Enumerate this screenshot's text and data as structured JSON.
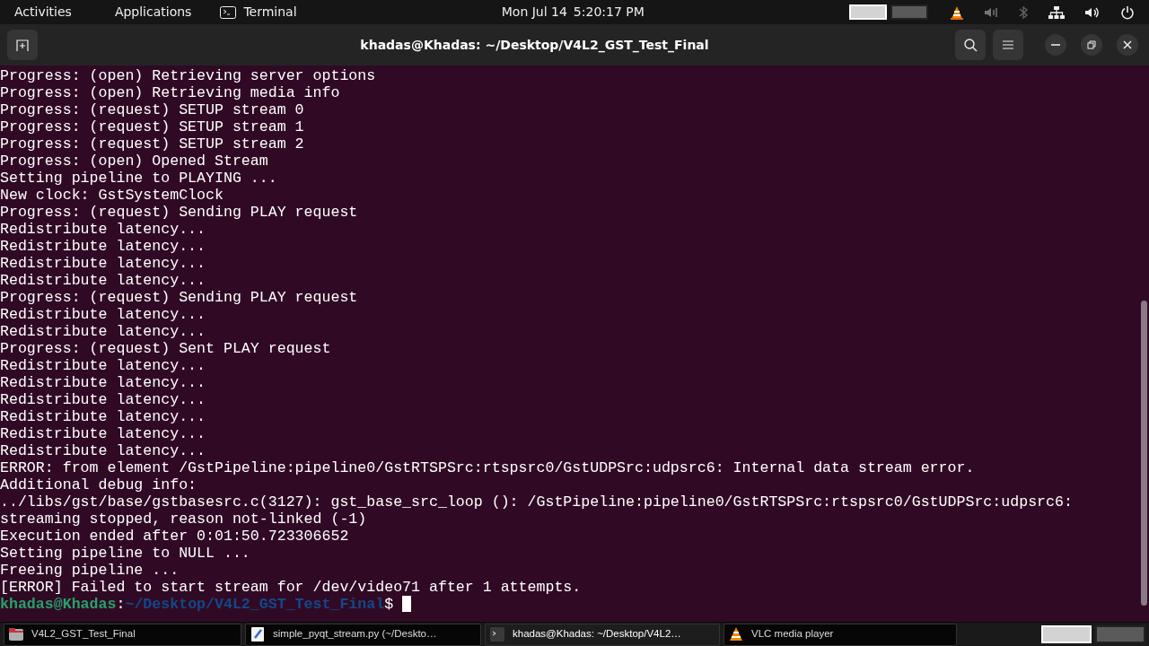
{
  "top_bar": {
    "activities": "Activities",
    "applications": "Applications",
    "app_name": "Terminal",
    "clock": "Mon Jul 14  5:20:17 PM",
    "workspaces": [
      {
        "selected": true
      },
      {
        "selected": false
      }
    ]
  },
  "window": {
    "title": "khadas@Khadas: ~/Desktop/V4L2_GST_Test_Final"
  },
  "terminal": {
    "lines": [
      "Progress: (open) Retrieving server options",
      "Progress: (open) Retrieving media info",
      "Progress: (request) SETUP stream 0",
      "Progress: (request) SETUP stream 1",
      "Progress: (request) SETUP stream 2",
      "Progress: (open) Opened Stream",
      "Setting pipeline to PLAYING ...",
      "New clock: GstSystemClock",
      "Progress: (request) Sending PLAY request",
      "Redistribute latency...",
      "Redistribute latency...",
      "Redistribute latency...",
      "Redistribute latency...",
      "Progress: (request) Sending PLAY request",
      "Redistribute latency...",
      "Redistribute latency...",
      "Progress: (request) Sent PLAY request",
      "Redistribute latency...",
      "Redistribute latency...",
      "Redistribute latency...",
      "Redistribute latency...",
      "Redistribute latency...",
      "Redistribute latency...",
      "ERROR: from element /GstPipeline:pipeline0/GstRTSPSrc:rtspsrc0/GstUDPSrc:udpsrc6: Internal data stream error.",
      "Additional debug info:",
      "../libs/gst/base/gstbasesrc.c(3127): gst_base_src_loop (): /GstPipeline:pipeline0/GstRTSPSrc:rtspsrc0/GstUDPSrc:udpsrc6:",
      "streaming stopped, reason not-linked (-1)",
      "Execution ended after 0:01:50.723306652",
      "Setting pipeline to NULL ...",
      "Freeing pipeline ...",
      "[ERROR] Failed to start stream for /dev/video71 after 1 attempts."
    ],
    "prompt": {
      "user": "khadas@Khadas",
      "separator": ":",
      "path": "~/Desktop/V4L2_GST_Test_Final",
      "symbol": "$"
    }
  },
  "taskbar": {
    "items": [
      {
        "kind": "folder",
        "label": "V4L2_GST_Test_Final",
        "selected": false
      },
      {
        "kind": "editor",
        "label": "simple_pyqt_stream.py (~/Deskto…",
        "selected": false
      },
      {
        "kind": "terminal",
        "label": "khadas@Khadas: ~/Desktop/V4L2…",
        "selected": true
      },
      {
        "kind": "vlc",
        "label": "VLC media player",
        "selected": false
      }
    ],
    "workspaces": [
      {
        "selected": true
      },
      {
        "selected": false
      }
    ]
  }
}
